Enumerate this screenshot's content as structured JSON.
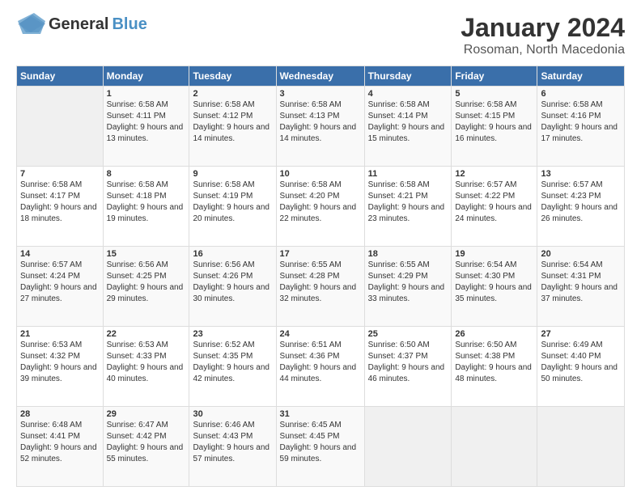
{
  "header": {
    "logo_general": "General",
    "logo_blue": "Blue",
    "title": "January 2024",
    "subtitle": "Rosoman, North Macedonia"
  },
  "calendar": {
    "days_of_week": [
      "Sunday",
      "Monday",
      "Tuesday",
      "Wednesday",
      "Thursday",
      "Friday",
      "Saturday"
    ],
    "weeks": [
      [
        {
          "date": "",
          "info": ""
        },
        {
          "date": "1",
          "info": "Sunrise: 6:58 AM\nSunset: 4:11 PM\nDaylight: 9 hours and 13 minutes."
        },
        {
          "date": "2",
          "info": "Sunrise: 6:58 AM\nSunset: 4:12 PM\nDaylight: 9 hours and 14 minutes."
        },
        {
          "date": "3",
          "info": "Sunrise: 6:58 AM\nSunset: 4:13 PM\nDaylight: 9 hours and 14 minutes."
        },
        {
          "date": "4",
          "info": "Sunrise: 6:58 AM\nSunset: 4:14 PM\nDaylight: 9 hours and 15 minutes."
        },
        {
          "date": "5",
          "info": "Sunrise: 6:58 AM\nSunset: 4:15 PM\nDaylight: 9 hours and 16 minutes."
        },
        {
          "date": "6",
          "info": "Sunrise: 6:58 AM\nSunset: 4:16 PM\nDaylight: 9 hours and 17 minutes."
        }
      ],
      [
        {
          "date": "7",
          "info": "Sunrise: 6:58 AM\nSunset: 4:17 PM\nDaylight: 9 hours and 18 minutes."
        },
        {
          "date": "8",
          "info": "Sunrise: 6:58 AM\nSunset: 4:18 PM\nDaylight: 9 hours and 19 minutes."
        },
        {
          "date": "9",
          "info": "Sunrise: 6:58 AM\nSunset: 4:19 PM\nDaylight: 9 hours and 20 minutes."
        },
        {
          "date": "10",
          "info": "Sunrise: 6:58 AM\nSunset: 4:20 PM\nDaylight: 9 hours and 22 minutes."
        },
        {
          "date": "11",
          "info": "Sunrise: 6:58 AM\nSunset: 4:21 PM\nDaylight: 9 hours and 23 minutes."
        },
        {
          "date": "12",
          "info": "Sunrise: 6:57 AM\nSunset: 4:22 PM\nDaylight: 9 hours and 24 minutes."
        },
        {
          "date": "13",
          "info": "Sunrise: 6:57 AM\nSunset: 4:23 PM\nDaylight: 9 hours and 26 minutes."
        }
      ],
      [
        {
          "date": "14",
          "info": "Sunrise: 6:57 AM\nSunset: 4:24 PM\nDaylight: 9 hours and 27 minutes."
        },
        {
          "date": "15",
          "info": "Sunrise: 6:56 AM\nSunset: 4:25 PM\nDaylight: 9 hours and 29 minutes."
        },
        {
          "date": "16",
          "info": "Sunrise: 6:56 AM\nSunset: 4:26 PM\nDaylight: 9 hours and 30 minutes."
        },
        {
          "date": "17",
          "info": "Sunrise: 6:55 AM\nSunset: 4:28 PM\nDaylight: 9 hours and 32 minutes."
        },
        {
          "date": "18",
          "info": "Sunrise: 6:55 AM\nSunset: 4:29 PM\nDaylight: 9 hours and 33 minutes."
        },
        {
          "date": "19",
          "info": "Sunrise: 6:54 AM\nSunset: 4:30 PM\nDaylight: 9 hours and 35 minutes."
        },
        {
          "date": "20",
          "info": "Sunrise: 6:54 AM\nSunset: 4:31 PM\nDaylight: 9 hours and 37 minutes."
        }
      ],
      [
        {
          "date": "21",
          "info": "Sunrise: 6:53 AM\nSunset: 4:32 PM\nDaylight: 9 hours and 39 minutes."
        },
        {
          "date": "22",
          "info": "Sunrise: 6:53 AM\nSunset: 4:33 PM\nDaylight: 9 hours and 40 minutes."
        },
        {
          "date": "23",
          "info": "Sunrise: 6:52 AM\nSunset: 4:35 PM\nDaylight: 9 hours and 42 minutes."
        },
        {
          "date": "24",
          "info": "Sunrise: 6:51 AM\nSunset: 4:36 PM\nDaylight: 9 hours and 44 minutes."
        },
        {
          "date": "25",
          "info": "Sunrise: 6:50 AM\nSunset: 4:37 PM\nDaylight: 9 hours and 46 minutes."
        },
        {
          "date": "26",
          "info": "Sunrise: 6:50 AM\nSunset: 4:38 PM\nDaylight: 9 hours and 48 minutes."
        },
        {
          "date": "27",
          "info": "Sunrise: 6:49 AM\nSunset: 4:40 PM\nDaylight: 9 hours and 50 minutes."
        }
      ],
      [
        {
          "date": "28",
          "info": "Sunrise: 6:48 AM\nSunset: 4:41 PM\nDaylight: 9 hours and 52 minutes."
        },
        {
          "date": "29",
          "info": "Sunrise: 6:47 AM\nSunset: 4:42 PM\nDaylight: 9 hours and 55 minutes."
        },
        {
          "date": "30",
          "info": "Sunrise: 6:46 AM\nSunset: 4:43 PM\nDaylight: 9 hours and 57 minutes."
        },
        {
          "date": "31",
          "info": "Sunrise: 6:45 AM\nSunset: 4:45 PM\nDaylight: 9 hours and 59 minutes."
        },
        {
          "date": "",
          "info": ""
        },
        {
          "date": "",
          "info": ""
        },
        {
          "date": "",
          "info": ""
        }
      ]
    ]
  }
}
